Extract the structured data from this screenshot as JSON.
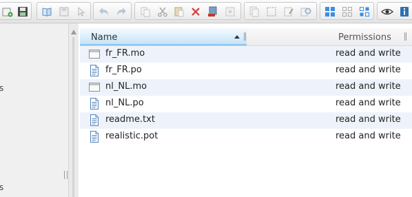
{
  "toolbar": {
    "groups": [
      {
        "name": "file",
        "buttons": [
          "new-folder-icon",
          "save-icon"
        ]
      },
      {
        "name": "edit",
        "buttons": [
          "open-book-icon",
          "disk-icon",
          "cursor-icon"
        ]
      },
      {
        "name": "history",
        "buttons": [
          "undo-icon",
          "redo-icon"
        ]
      },
      {
        "name": "clipboard",
        "buttons": [
          "copy-icon",
          "cut-icon",
          "paste-icon",
          "delete-icon",
          "extract-icon",
          "compress-icon"
        ]
      },
      {
        "name": "tools",
        "buttons": [
          "duplicate-icon",
          "select-icon",
          "rename-icon",
          "settings-icon"
        ]
      },
      {
        "name": "view",
        "buttons": [
          "icons-view-icon",
          "small-icons-view-icon",
          "list-view-icon"
        ]
      },
      {
        "name": "preview",
        "buttons": [
          "eye-icon",
          "info-icon"
        ]
      }
    ],
    "accent": "#3a8ee6"
  },
  "navpane": {
    "partial_items": [
      "s",
      "s"
    ]
  },
  "filelist": {
    "columns": {
      "name": "Name",
      "permissions": "Permissions"
    },
    "sort": "ascending",
    "rows": [
      {
        "name": "fr_FR.mo",
        "permissions": "read and write",
        "icon": "binary-file-icon"
      },
      {
        "name": "fr_FR.po",
        "permissions": "read and write",
        "icon": "text-file-icon"
      },
      {
        "name": "nl_NL.mo",
        "permissions": "read and write",
        "icon": "binary-file-icon"
      },
      {
        "name": "nl_NL.po",
        "permissions": "read and write",
        "icon": "text-file-icon"
      },
      {
        "name": "readme.txt",
        "permissions": "read and write",
        "icon": "text-file-icon"
      },
      {
        "name": "realistic.pot",
        "permissions": "read and write",
        "icon": "text-file-icon"
      }
    ],
    "alt_row_color": "#eef3fb",
    "header_highlight": "#c6e3f7"
  }
}
